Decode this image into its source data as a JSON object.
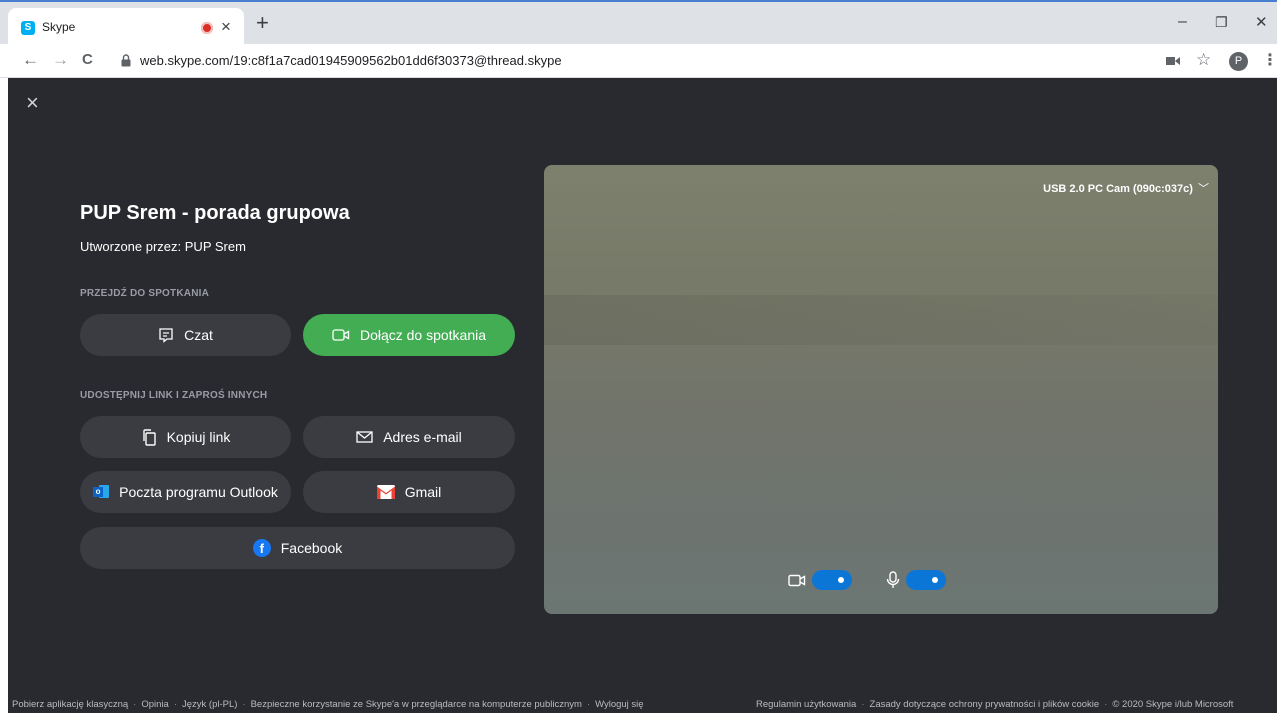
{
  "browser": {
    "tab_title": "Skype",
    "favicon_letter": "S",
    "url": "web.skype.com/19:c8f1a7cad01945909562b01dd6f30373@thread.skype",
    "profile_letter": "P",
    "close_tab": "×",
    "new_tab": "+",
    "minimize": "–",
    "restore": "❐",
    "close_window": "✕",
    "back": "←",
    "forward": "→",
    "reload": "C",
    "star": "☆",
    "menu": "⋮"
  },
  "meeting": {
    "title": "PUP Srem - porada grupowa",
    "created_by": "Utworzone przez: PUP Srem",
    "go_to_section": "PRZEJDŹ DO SPOTKANIA",
    "chat_label": "Czat",
    "join_label": "Dołącz do spotkania",
    "share_section": "UDOSTĘPNIJ LINK I ZAPROŚ INNYCH",
    "copy_link_label": "Kopiuj link",
    "email_label": "Adres e-mail",
    "outlook_label": "Poczta programu Outlook",
    "gmail_label": "Gmail",
    "facebook_label": "Facebook",
    "close": "×"
  },
  "preview": {
    "camera_name": "USB 2.0 PC Cam (090c:037c)",
    "video_on": true,
    "mic_on": true
  },
  "footer": {
    "left": [
      "Pobierz aplikację klasyczną",
      "Opinia",
      "Język (pl-PL)",
      "Bezpieczne korzystanie ze Skype'a w przeglądarce na komputerze publicznym",
      "Wyloguj się"
    ],
    "right": [
      "Regulamin użytkowania",
      "Zasady dotyczące ochrony prywatności i plików cookie",
      "© 2020 Skype i/lub Microsoft"
    ],
    "separator": "·"
  },
  "colors": {
    "app_bg": "#292a2f",
    "button_bg": "#3b3c42",
    "join_green": "#43ad54",
    "toggle_blue": "#0b76d6"
  }
}
